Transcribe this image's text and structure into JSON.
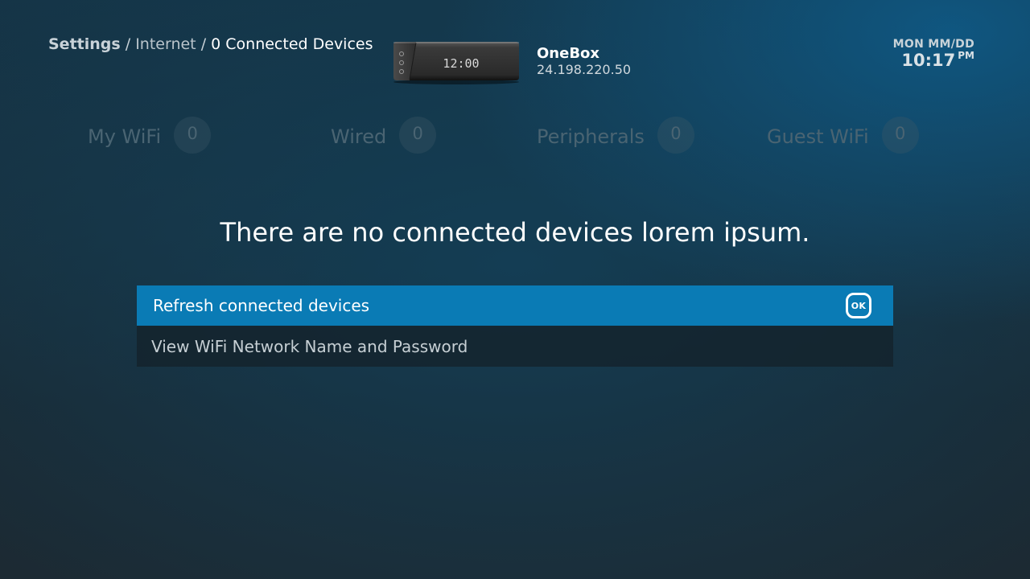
{
  "breadcrumb": {
    "root": "Settings",
    "separator": "/",
    "section": "Internet",
    "current": "0 Connected Devices"
  },
  "device": {
    "display_time": "12:00",
    "name": "OneBox",
    "ip": "24.198.220.50"
  },
  "clock": {
    "date": "MON MM/DD",
    "time": "10:17",
    "ampm": "PM"
  },
  "tabs": [
    {
      "label": "My WiFi",
      "count": "0"
    },
    {
      "label": "Wired",
      "count": "0"
    },
    {
      "label": "Peripherals",
      "count": "0"
    },
    {
      "label": "Guest WiFi",
      "count": "0"
    }
  ],
  "message": "There are no connected devices lorem ipsum.",
  "options": [
    {
      "label": "Refresh connected devices",
      "badge": "OK"
    },
    {
      "label": "View WiFi Network Name and Password"
    }
  ],
  "colors": {
    "accent": "#0a7bb5",
    "tab_dim": "#4a6472"
  }
}
